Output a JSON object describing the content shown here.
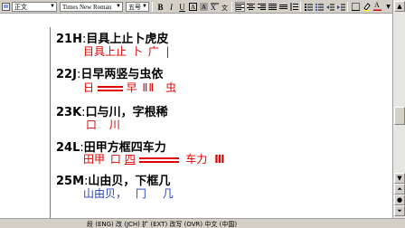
{
  "toolbar": {
    "style_value": "正文",
    "font_value": "Times New Roman",
    "size_value": "五号",
    "bold_label": "B",
    "italic_label": "I",
    "underline_label": "U",
    "font_color_label": "A"
  },
  "entries": [
    {
      "code": "21H",
      "sep": ":",
      "chars": "目具上止卜虎皮",
      "line2_a": "目具上止",
      "line2_b": "卜",
      "line2_c": "广",
      "line2_d": "|"
    },
    {
      "code": "22J",
      "sep": ":",
      "chars": "日早两竖与虫依",
      "line2_a": "日",
      "line2_b": "早",
      "line2_c": "虫"
    },
    {
      "code": "23K",
      "sep": ":",
      "chars": "口与川，字根稀",
      "line2_a": "口",
      "line2_b": "川"
    },
    {
      "code": "24L",
      "sep": ":",
      "chars": "田甲方框四车力",
      "line2_a": "田甲",
      "line2_b": "口",
      "line2_c": "四",
      "line2_d": "车力"
    },
    {
      "code": "25M",
      "sep": ":",
      "chars": "山由贝，下框几",
      "line2_a": "山由贝，",
      "line2_b": "冂",
      "line2_c": "几"
    }
  ],
  "statusbar": {
    "text": "段  (ENG) 改 (JCH) 扩 (EXT) 改写 (OVR) 中文 (中国)"
  },
  "colors": {
    "red": "#e00000",
    "blue": "#1e3cc0",
    "toolbar_bg": "#d4d0c8"
  }
}
